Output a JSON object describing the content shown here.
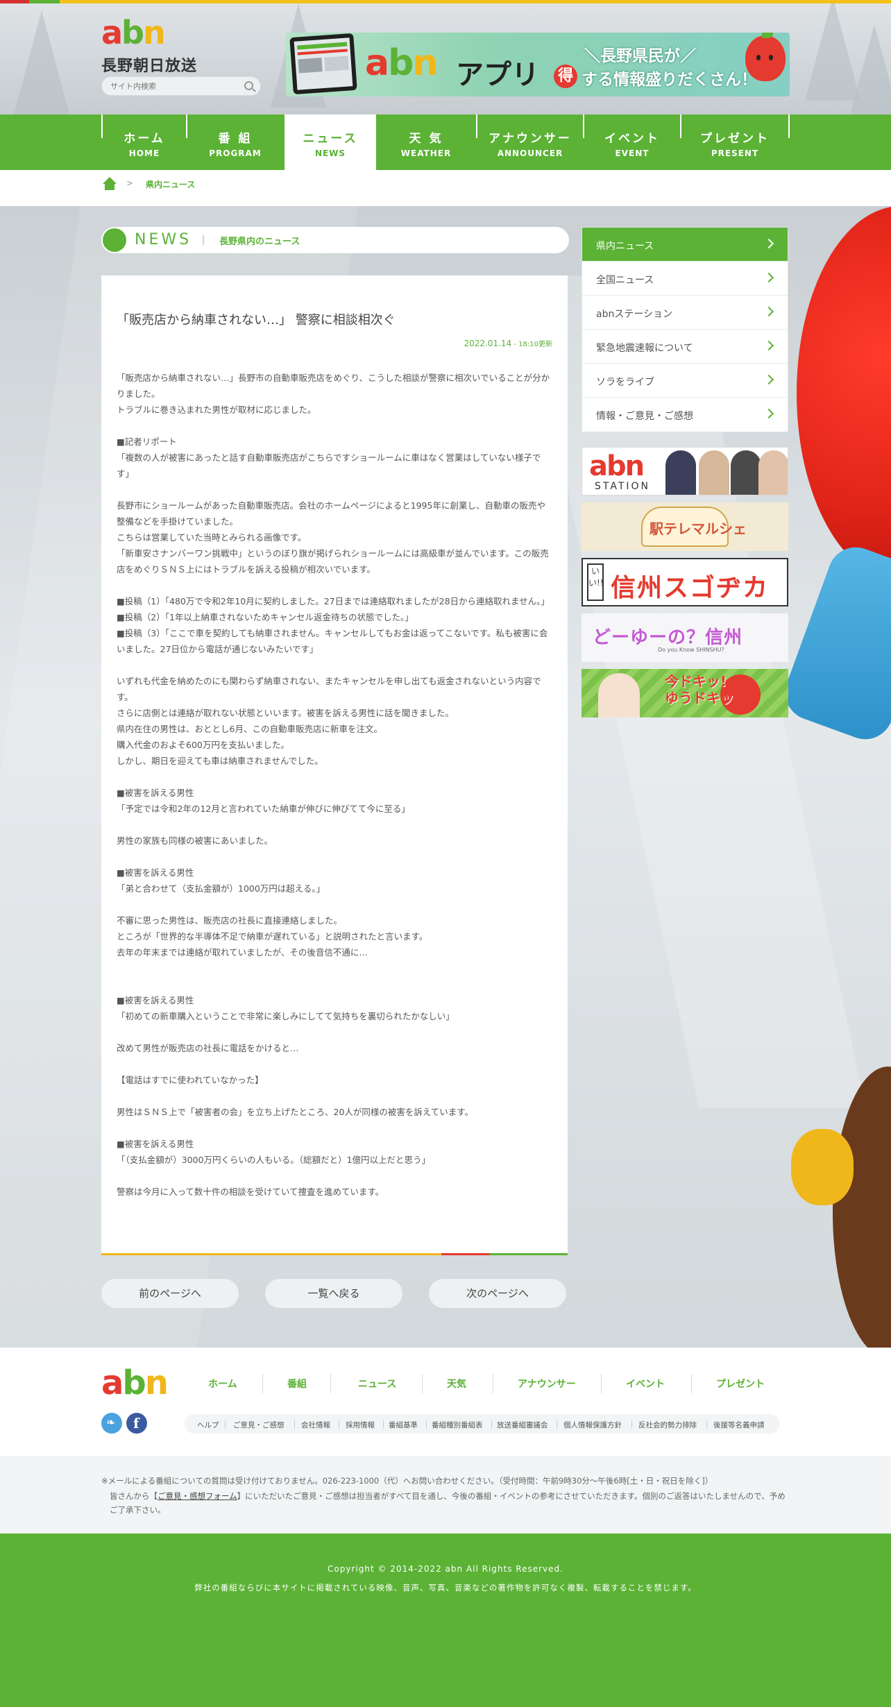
{
  "header": {
    "logo_text": "abn",
    "logo_subtitle": "長野朝日放送",
    "search_placeholder": "サイト内検索",
    "app_banner": {
      "title": "アプリ",
      "line1": "＼長野県民が／",
      "line2": "する情報盛りだくさん！",
      "badge": "得"
    }
  },
  "nav": [
    {
      "jp": "ホーム",
      "en": "HOME"
    },
    {
      "jp": "番 組",
      "en": "PROGRAM"
    },
    {
      "jp": "ニュース",
      "en": "NEWS",
      "active": true
    },
    {
      "jp": "天 気",
      "en": "WEATHER"
    },
    {
      "jp": "アナウンサー",
      "en": "ANNOUNCER"
    },
    {
      "jp": "イベント",
      "en": "EVENT"
    },
    {
      "jp": "プレゼント",
      "en": "PRESENT"
    }
  ],
  "breadcrumb": {
    "sep": ">",
    "current": "県内ニュース"
  },
  "news_header": {
    "label": "NEWS",
    "sub": "長野県内のニュース"
  },
  "article": {
    "title": "「販売店から納車されない…」 警察に相談相次ぐ",
    "date": "2022.01.14",
    "updated": " - 18:10更新",
    "paragraphs": [
      "「販売店から納車されない…」長野市の自動車販売店をめぐり、こうした相談が警察に相次いでいることが分かりました。",
      "トラブルに巻き込まれた男性が取材に応じました。",
      "",
      "■記者リポート",
      "「複数の人が被害にあったと話す自動車販売店がこちらですショールームに車はなく営業はしていない様子です」",
      "",
      "長野市にショールームがあった自動車販売店。会社のホームページによると1995年に創業し、自動車の販売や整備などを手掛けていました。",
      "こちらは営業していた当時とみられる画像です。",
      "「新車安さナンバーワン挑戦中」というのぼり旗が掲げられショールームには高級車が並んでいます。この販売店をめぐりＳＮＳ上にはトラブルを訴える投稿が相次いでいます。",
      "",
      "■投稿（1）「480万で令和2年10月に契約しました。27日までは連絡取れましたが28日から連絡取れません。」",
      "■投稿（2）「1年以上納車されないためキャンセル返金待ちの状態でした。」",
      "■投稿（3）「ここで車を契約しても納車されません。キャンセルしてもお金は返ってこないです。私も被害に会いました。27日位から電話が通じないみたいです」",
      "",
      "いずれも代金を納めたのにも関わらず納車されない、またキャンセルを申し出ても返金されないという内容です。",
      "さらに店側とは連絡が取れない状態といいます。被害を訴える男性に話を聞きました。",
      "県内在住の男性は、おととし6月、この自動車販売店に新車を注文。",
      "購入代金のおよそ600万円を支払いました。",
      "しかし、期日を迎えても車は納車されませんでした。",
      "",
      "■被害を訴える男性",
      "「予定では令和2年の12月と言われていた納車が伸びに伸びてて今に至る」",
      "",
      "男性の家族も同様の被害にあいました。",
      "",
      "■被害を訴える男性",
      "「弟と合わせて（支払金額が）1000万円は超える。」",
      "",
      "不審に思った男性は、販売店の社長に直接連絡しました。",
      "ところが「世界的な半導体不足で納車が遅れている」と説明されたと言います。",
      "去年の年末までは連絡が取れていましたが、その後音信不通に…",
      "",
      "",
      "■被害を訴える男性",
      "「初めての新車購入ということで非常に楽しみにしてて気持ちを裏切られたかなしい」",
      "",
      "改めて男性が販売店の社長に電話をかけると…",
      "",
      "【電話はすでに使われていなかった】",
      "",
      "男性はＳＮＳ上で「被害者の会」を立ち上げたところ、20人が同様の被害を訴えています。",
      "",
      "■被害を訴える男性",
      "「（支払金額が）3000万円くらいの人もいる。（総額だと）1億円以上だと思う」",
      "",
      "警察は今月に入って数十件の相談を受けていて捜査を進めています。"
    ]
  },
  "pager": {
    "prev": "前のページへ",
    "list": "一覧へ戻る",
    "next": "次のページへ"
  },
  "sidebar": [
    {
      "label": "県内ニュース",
      "active": true
    },
    {
      "label": "全国ニュース"
    },
    {
      "label": "abnステーション"
    },
    {
      "label": "緊急地震速報について"
    },
    {
      "label": "ソラをライブ"
    },
    {
      "label": "情報・ご意見・ご感想"
    }
  ],
  "banners": {
    "station": {
      "logo": "abn",
      "sub": "STATION"
    },
    "ekimarche": "駅テレマルシェ",
    "sugochikara": "信州スゴヂカラ",
    "sugochikara_badge": "いい!!",
    "doshinshu": "どーゆーの？信州",
    "doshinshu_sub": "Do you Know SHINSHU?",
    "imadoki": "今ドキッ!\nゆうドキッ"
  },
  "footer": {
    "logo_text": "abn",
    "nav": [
      "ホーム",
      "番組",
      "ニュース",
      "天気",
      "アナウンサー",
      "イベント",
      "プレゼント"
    ],
    "links": [
      "ヘルプ",
      "ご意見・ご感想",
      "会社情報",
      "採用情報",
      "番組基準",
      "番組種別番組表",
      "放送番組審議会",
      "個人情報保護方針",
      "反社会的勢力排除",
      "後援等名義申請"
    ]
  },
  "notice": {
    "line1": "※メールによる番組についての質問は受け付けておりません。026-223-1000（代）へお問い合わせください。（受付時間：午前9時30分〜午後6時[土・日・祝日を除く]）",
    "line2_pre": "皆さんから【",
    "line2_link": "ご意見・感想フォーム",
    "line2_post": "】にいただいたご意見・ご感想は担当者がすべて目を通し、今後の番組・イベントの参考にさせていただきます。個別のご返答はいたしませんので、予めご了承下さい。"
  },
  "copyright": {
    "line1": "Copyright © 2014-2022 abn All Rights Reserved.",
    "line2": "弊社の番組ならびに本サイトに掲載されている映像、音声、写真、音楽などの著作物を許可なく複製、転載することを禁じます。"
  },
  "colors": {
    "accent_green": "#5bb235",
    "red": "#e53a2f",
    "yellow": "#f0b71a"
  }
}
